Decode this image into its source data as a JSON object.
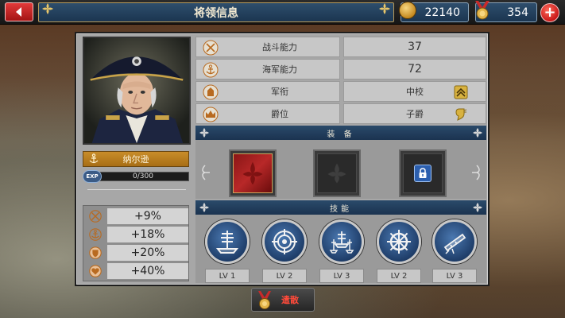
{
  "header": {
    "title": "将领信息",
    "gold": "22140",
    "medals": "354",
    "plus_label": "+"
  },
  "admiral": {
    "name": "纳尔逊",
    "exp_label": "EXP",
    "exp_value": "0/300",
    "bonuses": [
      {
        "icon": "crossed-swords-icon",
        "value": "+9%"
      },
      {
        "icon": "anchor-icon",
        "value": "+18%"
      },
      {
        "icon": "shield-icon",
        "value": "+20%"
      },
      {
        "icon": "heart-icon",
        "value": "+40%"
      }
    ]
  },
  "stats": [
    {
      "icon": "crossed-swords-icon",
      "label": "战斗能力",
      "value": "37"
    },
    {
      "icon": "anchor-icon",
      "label": "海军能力",
      "value": "72"
    },
    {
      "icon": "rank-insignia-icon",
      "label": "军衔",
      "value": "中校"
    },
    {
      "icon": "crown-icon",
      "label": "爵位",
      "value": "子爵"
    }
  ],
  "equipment": {
    "title": "装 备",
    "slots": [
      {
        "state": "equipped",
        "icon": "red-fleur-icon"
      },
      {
        "state": "empty",
        "icon": "fleur-icon"
      },
      {
        "state": "locked",
        "icon": "lock-icon"
      }
    ]
  },
  "skills": {
    "title": "技能",
    "items": [
      {
        "icon": "warship-icon",
        "level": "LV 1"
      },
      {
        "icon": "target-icon",
        "level": "LV 2"
      },
      {
        "icon": "fleet-icon",
        "level": "LV 3"
      },
      {
        "icon": "ship-wheel-icon",
        "level": "LV 2"
      },
      {
        "icon": "telescope-icon",
        "level": "LV 3"
      }
    ]
  },
  "footer": {
    "disband_label": "遣散"
  },
  "colors": {
    "accent_gold": "#c98d2a",
    "header_blue": "#1b3350",
    "close_red": "#c91919"
  }
}
